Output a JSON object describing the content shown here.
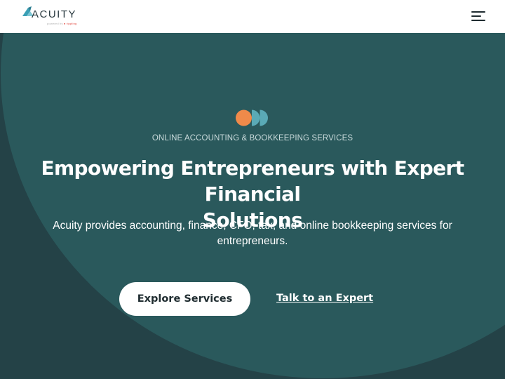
{
  "header": {
    "logo_text": "ACUITY",
    "logo_tagline": "powered by",
    "logo_tagline_brand": "● rippling",
    "menu_icon": "hamburger-menu-icon"
  },
  "hero": {
    "icon": "three-dots-logo-icon",
    "eyebrow": "ONLINE ACCOUNTING & BOOKKEEPING SERVICES",
    "headline_line1": "Empowering Entrepreneurs with Expert Financial",
    "headline_line2": "Solutions",
    "subtext_line1": "Acuity provides accounting, finance, CFO, tax, and online bookkeeping services for",
    "subtext_line2": "entrepreneurs.",
    "primary_cta": "Explore Services",
    "secondary_cta": "Talk to an Expert"
  },
  "colors": {
    "header_bg": "#ffffff",
    "hero_bg_dark": "#244247",
    "hero_bg_circle": "#2a595c",
    "accent_orange": "#ef8a4a",
    "accent_teal": "#5aaab6",
    "logo_teal": "#3a9fb5"
  }
}
